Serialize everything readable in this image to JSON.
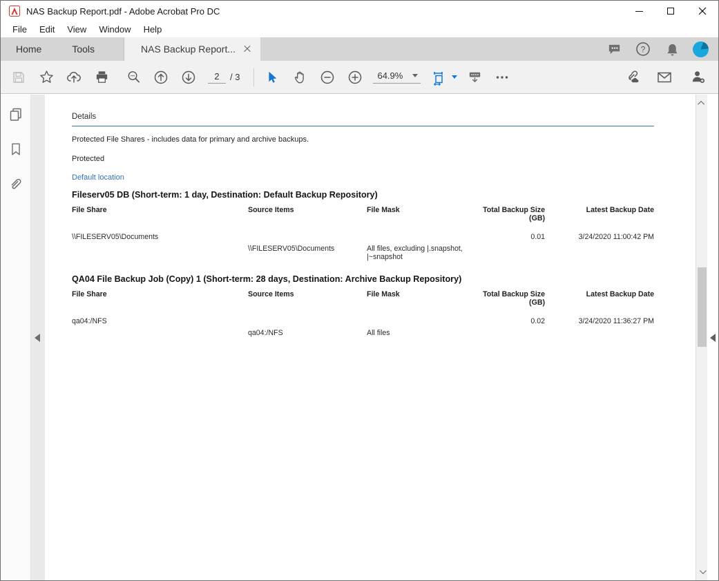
{
  "window": {
    "title": "NAS Backup Report.pdf - Adobe Acrobat Pro DC"
  },
  "menu": {
    "items": [
      "File",
      "Edit",
      "View",
      "Window",
      "Help"
    ]
  },
  "tab_bar": {
    "home": "Home",
    "tools": "Tools",
    "document_tab": "NAS Backup Report..."
  },
  "toolbar": {
    "page_current": "2",
    "page_total_suffix": "/ 3",
    "zoom_value": "64.9%"
  },
  "icons": {
    "app_logo": "acrobat-pdf-logo",
    "titlebar": [
      "minimize",
      "maximize",
      "close"
    ],
    "tabbar_right": [
      "comment-bubble",
      "help-circle",
      "bell",
      "avatar"
    ],
    "toolbar_left": [
      "save-floppy",
      "star",
      "cloud-upload",
      "printer",
      "search-magnifier",
      "page-up-circle",
      "page-down-circle"
    ],
    "toolbar_mid": [
      "select-pointer",
      "hand-pan",
      "zoom-out-circle",
      "zoom-in-circle",
      "fit-width-page",
      "hide-toolbar",
      "more-ellipsis"
    ],
    "toolbar_right": [
      "share-link-cloud",
      "email-envelope",
      "add-person"
    ],
    "left_panel": [
      "page-thumbnails",
      "bookmarks",
      "attachments-paperclip"
    ],
    "scrollbar": [
      "chevron-up",
      "chevron-down"
    ],
    "panel_toggles": [
      "collapse-left-triangle",
      "collapse-right-triangle"
    ]
  },
  "colors": {
    "accent_blue": "#2e74b5",
    "tool_blue": "#1377d6",
    "avatar_blue": "#1aa7de",
    "tabbar_gray": "#d5d5d5",
    "toolbar_gray": "#f1f1f1"
  },
  "content": {
    "details_title": "Details",
    "intro": "Protected File Shares - includes data for primary and archive backups.",
    "protected_label": "Protected",
    "location_link": "Default location",
    "columns": [
      "File Share",
      "Source Items",
      "File Mask",
      "Total Backup Size (GB)",
      "Latest Backup Date"
    ],
    "jobs": [
      {
        "heading": "Fileserv05 DB (Short-term: 1 day, Destination: Default Backup Repository)",
        "rows": [
          {
            "file_share": "\\\\FILESERV05\\Documents",
            "source_items": "",
            "file_mask": "",
            "total_backup_size_gb": "0.01",
            "latest_backup_date": "3/24/2020 11:00:42 PM"
          },
          {
            "file_share": "",
            "source_items": "\\\\FILESERV05\\Documents",
            "file_mask": "All files, excluding |.snapshot, |~snapshot",
            "total_backup_size_gb": "",
            "latest_backup_date": ""
          }
        ]
      },
      {
        "heading": "QA04 File Backup Job (Copy) 1 (Short-term: 28 days, Destination: Archive Backup Repository)",
        "rows": [
          {
            "file_share": "qa04:/NFS",
            "source_items": "",
            "file_mask": "",
            "total_backup_size_gb": "0.02",
            "latest_backup_date": "3/24/2020 11:36:27 PM"
          },
          {
            "file_share": "",
            "source_items": "qa04:/NFS",
            "file_mask": "All files",
            "total_backup_size_gb": "",
            "latest_backup_date": ""
          }
        ]
      }
    ]
  }
}
